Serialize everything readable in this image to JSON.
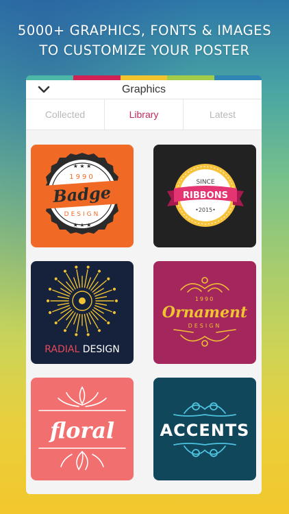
{
  "headline": {
    "line1": "5000+ GRAPHICS, FONTS & IMAGES",
    "line2": "TO CUSTOMIZE YOUR POSTER"
  },
  "colorbar": [
    "#4cb7a6",
    "#cf2356",
    "#f2c42f",
    "#a3cc4a",
    "#2f86b5"
  ],
  "panel": {
    "title": "Graphics",
    "tabs": [
      {
        "label": "Collected",
        "active": false
      },
      {
        "label": "Library",
        "active": true
      },
      {
        "label": "Latest",
        "active": false
      }
    ]
  },
  "tiles": [
    {
      "name": "badge-design",
      "background": "#f06a25",
      "text_top": "1990",
      "text_main": "Badge",
      "text_bottom": "DESIGN"
    },
    {
      "name": "ribbons",
      "background": "#222222",
      "text_top": "SINCE",
      "text_main": "RIBBONS",
      "text_bottom": "•2015•"
    },
    {
      "name": "radial-design",
      "background": "#16213b",
      "text_part1": "RADIAL",
      "text_part2": " DESIGN"
    },
    {
      "name": "ornament-design",
      "background": "#a3275d",
      "text_top": "1990",
      "text_main": "Ornament",
      "text_bottom": "DESIGN"
    },
    {
      "name": "floral",
      "background": "#f26f6f",
      "text_main": "floral"
    },
    {
      "name": "accents",
      "background": "#10475a",
      "text_main": "ACCENTS"
    }
  ],
  "colors": {
    "accent": "#c4285c",
    "tab_inactive": "#b8b8b8"
  }
}
